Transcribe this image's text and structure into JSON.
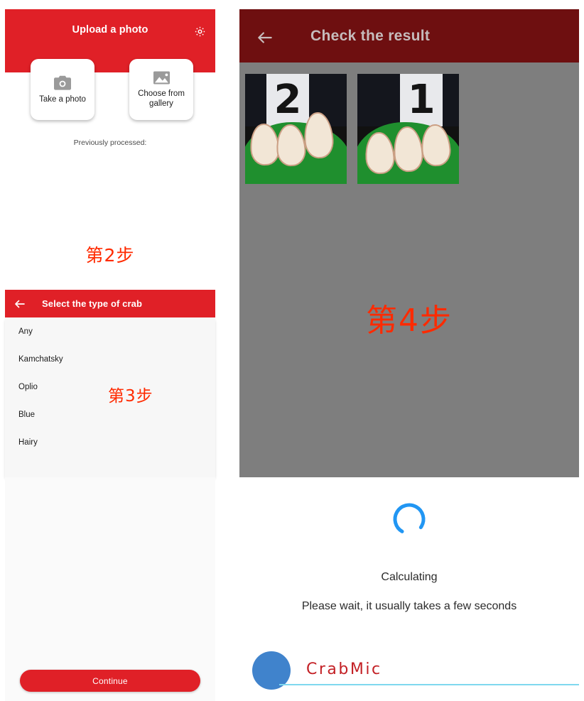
{
  "annotations": {
    "step2": "第2步",
    "step3": "第3步",
    "step4": "第4步"
  },
  "colors": {
    "primary_red": "#E02027",
    "dim_red": "#6E0F10",
    "annotation_red": "#FF2A00",
    "spinner_blue": "#2196F3",
    "brand_blue": "#4083CC",
    "brand_red": "#C32025",
    "brand_rule_cyan": "#7FD8EF",
    "canvas_gray": "#7E7E7E",
    "list_bg": "#F7F7F7"
  },
  "upload_screen": {
    "title": "Upload a photo",
    "settings_icon": "gear-icon",
    "cards": [
      {
        "icon": "camera-icon",
        "label": "Take a photo"
      },
      {
        "icon": "image-gallery-icon",
        "label": "Choose from gallery"
      }
    ],
    "previously_processed_label": "Previously processed:"
  },
  "crab_screen": {
    "back_icon": "arrow-left-icon",
    "title": "Select the type of crab",
    "options": [
      "Any",
      "Kamchatsky",
      "Oplio",
      "Blue",
      "Hairy"
    ],
    "continue_label": "Continue"
  },
  "result_screen": {
    "back_icon": "arrow-left-icon",
    "title": "Check the result",
    "thumbnails": [
      {
        "number": "2",
        "alt": "crab meat sample photo labelled 2"
      },
      {
        "number": "1",
        "alt": "crab meat sample photo labelled 1"
      }
    ],
    "loading": {
      "spinner_icon": "loading-spinner-icon",
      "title": "Calculating",
      "subtitle": "Please wait, it usually takes a few seconds"
    },
    "brand": {
      "logo_icon": "blue-circle-logo",
      "name": "CrabMic"
    }
  }
}
